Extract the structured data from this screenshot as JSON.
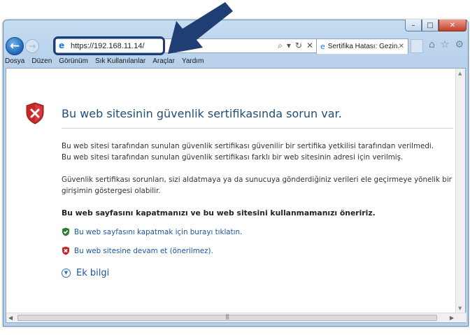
{
  "browser": {
    "address": "https://192.168.11.14/",
    "tab_label": "Sertifika Hatası: Gezin...",
    "address_tools": {
      "search": "⌕",
      "dropdown": "▾",
      "refresh": "↻",
      "stop": "✕"
    },
    "window_controls": {
      "minimize": "–",
      "maximize": "□",
      "close": "✕"
    }
  },
  "menubar": [
    "Dosya",
    "Düzen",
    "Görünüm",
    "Sık Kullanılanlar",
    "Araçlar",
    "Yardım"
  ],
  "page": {
    "title": "Bu web sitesinin güvenlik sertifikasında sorun var.",
    "para1_line1": "Bu web sitesi tarafından sunulan güvenlik sertifikası güvenilir bir sertifika yetkilisi tarafından verilmedi.",
    "para1_line2": "Bu web sitesi tarafından sunulan güvenlik sertifikası farklı bir web sitesinin adresi için verilmiş.",
    "para2_line1": "Güvenlik sertifikası sorunları, sizi aldatmaya ya da sunucuya gönderdiğiniz verileri ele geçirmeye yönelik bir",
    "para2_line2": "girişimin göstergesi olabilir.",
    "recommendation": "Bu web sayfasını kapatmanızı ve bu web sitesini kullanmamanızı öneririz.",
    "link_close": "Bu web sayfasını kapatmak için burayı tıklatın.",
    "link_continue": "Bu web sitesine devam et (önerilmez).",
    "more_info": "Ek bilgi"
  },
  "colors": {
    "arrow": "#1f3e73",
    "link": "#1b57a1",
    "title": "#1f4e79",
    "shield_error": "#c62828",
    "shield_ok": "#2e7d32"
  }
}
